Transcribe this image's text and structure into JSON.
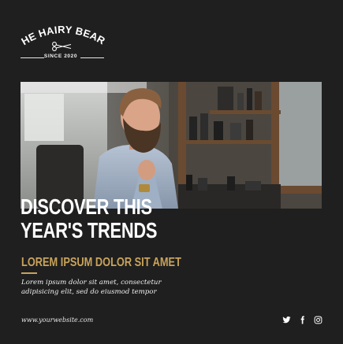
{
  "logo": {
    "brand": "THE HAIRY BEARD",
    "since": "SINCE 2020",
    "icon": "scissors-icon"
  },
  "headline": {
    "line1": "DISCOVER THIS",
    "line2": "YEAR'S TRENDS"
  },
  "subheading": "LOREM IPSUM DOLOR SIT AMET",
  "body": {
    "line1": "Lorem ipsum dolor sit amet, consectetur",
    "line2": "adipisicing elit, sed do eiusmod tempor"
  },
  "website": "www.yourwebsite.com",
  "social": [
    "twitter-icon",
    "facebook-icon",
    "instagram-icon"
  ],
  "colors": {
    "background": "#1f1f1f",
    "accent": "#c9a35a",
    "text": "#ffffff"
  }
}
